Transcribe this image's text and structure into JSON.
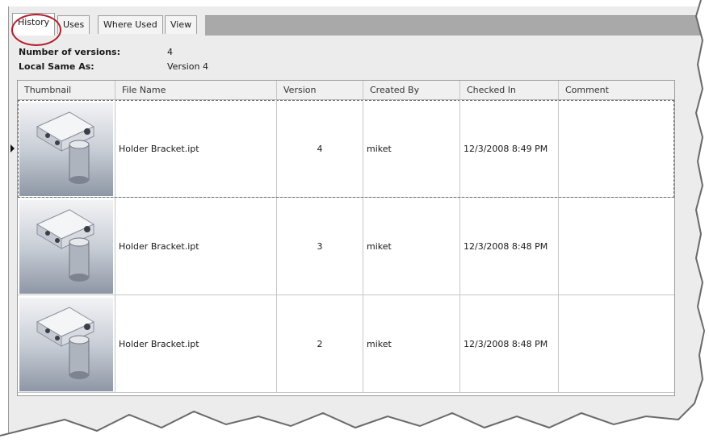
{
  "tabs": [
    {
      "label": "History",
      "active": true
    },
    {
      "label": "Uses",
      "active": false
    },
    {
      "label": "Where Used",
      "active": false
    },
    {
      "label": "View",
      "active": false
    }
  ],
  "info": {
    "versions_label": "Number of versions:",
    "versions_value": "4",
    "local_same_label": "Local Same As:",
    "local_same_value": "Version 4"
  },
  "columns": [
    "Thumbnail",
    "File Name",
    "Version",
    "Created By",
    "Checked In",
    "Comment"
  ],
  "rows": [
    {
      "file_name": "Holder Bracket.ipt",
      "version": "4",
      "created_by": "miket",
      "checked_in": "12/3/2008 8:49 PM",
      "comment": "",
      "selected": true
    },
    {
      "file_name": "Holder Bracket.ipt",
      "version": "3",
      "created_by": "miket",
      "checked_in": "12/3/2008 8:48 PM",
      "comment": "",
      "selected": false
    },
    {
      "file_name": "Holder Bracket.ipt",
      "version": "2",
      "created_by": "miket",
      "checked_in": "12/3/2008 8:48 PM",
      "comment": "",
      "selected": false
    }
  ],
  "icons": {
    "thumbnail": "bracket-part-thumbnail-icon",
    "row_indicator": "current-row-arrow-icon"
  },
  "colors": {
    "highlight_circle": "#b0202c",
    "tab_strip": "#a9a9a9",
    "panel": "#ececec"
  }
}
